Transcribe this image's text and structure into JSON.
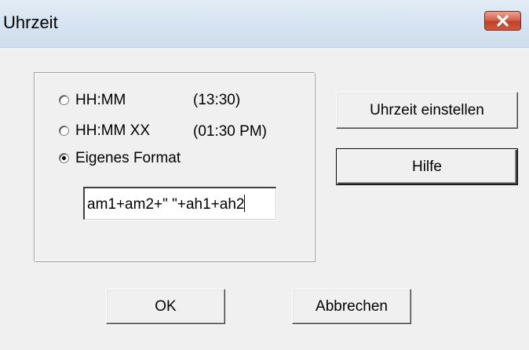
{
  "window": {
    "title": "Uhrzeit"
  },
  "format_options": [
    {
      "label": "HH:MM",
      "example": "(13:30)",
      "selected": false
    },
    {
      "label": "HH:MM XX",
      "example": "(01:30 PM)",
      "selected": false
    },
    {
      "label": "Eigenes Format",
      "example": "",
      "selected": true
    }
  ],
  "custom_format": {
    "value": "am1+am2+\" \"+ah1+ah2"
  },
  "buttons": {
    "set_time": "Uhrzeit einstellen",
    "help": "Hilfe",
    "ok": "OK",
    "cancel": "Abbrechen"
  },
  "icons": {
    "close": "close-icon",
    "radio": "radio-icon"
  },
  "colors": {
    "close_button": "#c1402a",
    "titlebar": "#d7e4f2",
    "dialog_background": "#f0f0f0"
  }
}
